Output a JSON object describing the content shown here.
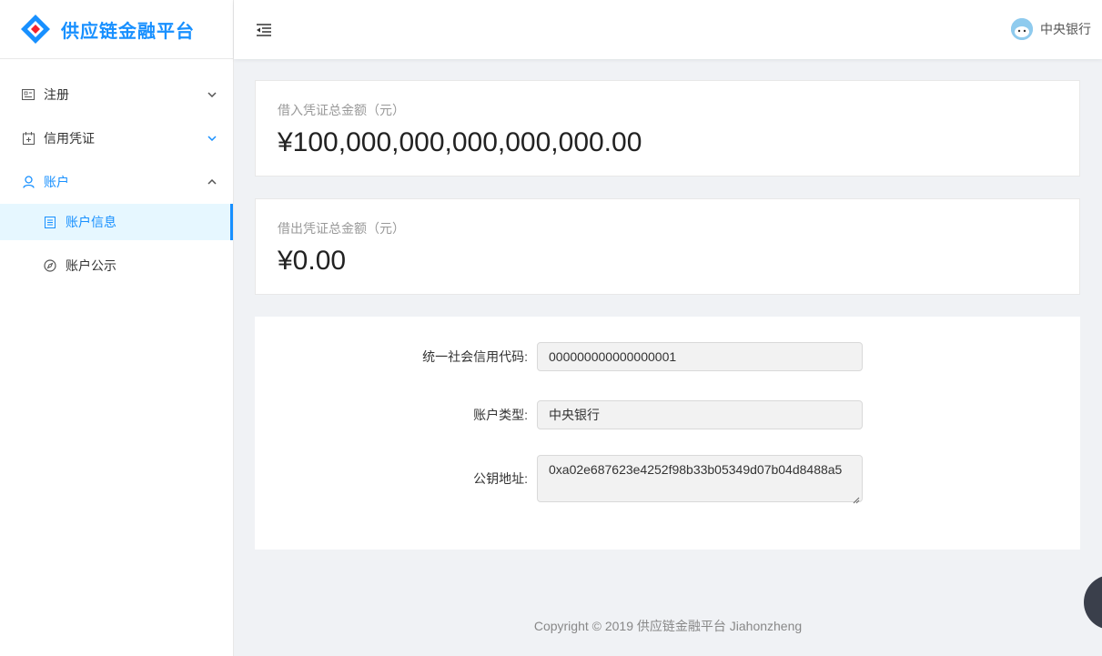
{
  "app": {
    "title": "供应链金融平台",
    "brand_color": "#1890ff"
  },
  "sidebar": {
    "items": [
      {
        "label": "注册",
        "icon": "id-card-icon",
        "state": "collapsed"
      },
      {
        "label": "信用凭证",
        "icon": "calendar-icon",
        "state": "collapsed"
      },
      {
        "label": "账户",
        "icon": "user-icon",
        "state": "expanded"
      }
    ],
    "sub_items": [
      {
        "label": "账户信息",
        "icon": "file-text-icon",
        "active": true
      },
      {
        "label": "账户公示",
        "icon": "compass-icon",
        "active": false
      }
    ]
  },
  "header": {
    "user_name": "中央银行"
  },
  "stats": [
    {
      "title": "借入凭证总金额（元）",
      "value": "¥100,000,000,000,000,000.00"
    },
    {
      "title": "借出凭证总金额（元）",
      "value": "¥0.00"
    }
  ],
  "form": {
    "credit_code_label": "统一社会信用代码:",
    "credit_code_value": "000000000000000001",
    "account_type_label": "账户类型:",
    "account_type_value": "中央银行",
    "public_key_label": "公钥地址:",
    "public_key_value": "0xa02e687623e4252f98b33b05349d07b04d8488a5"
  },
  "footer": {
    "text": "Copyright © 2019 供应链金融平台 Jiahonzheng"
  }
}
